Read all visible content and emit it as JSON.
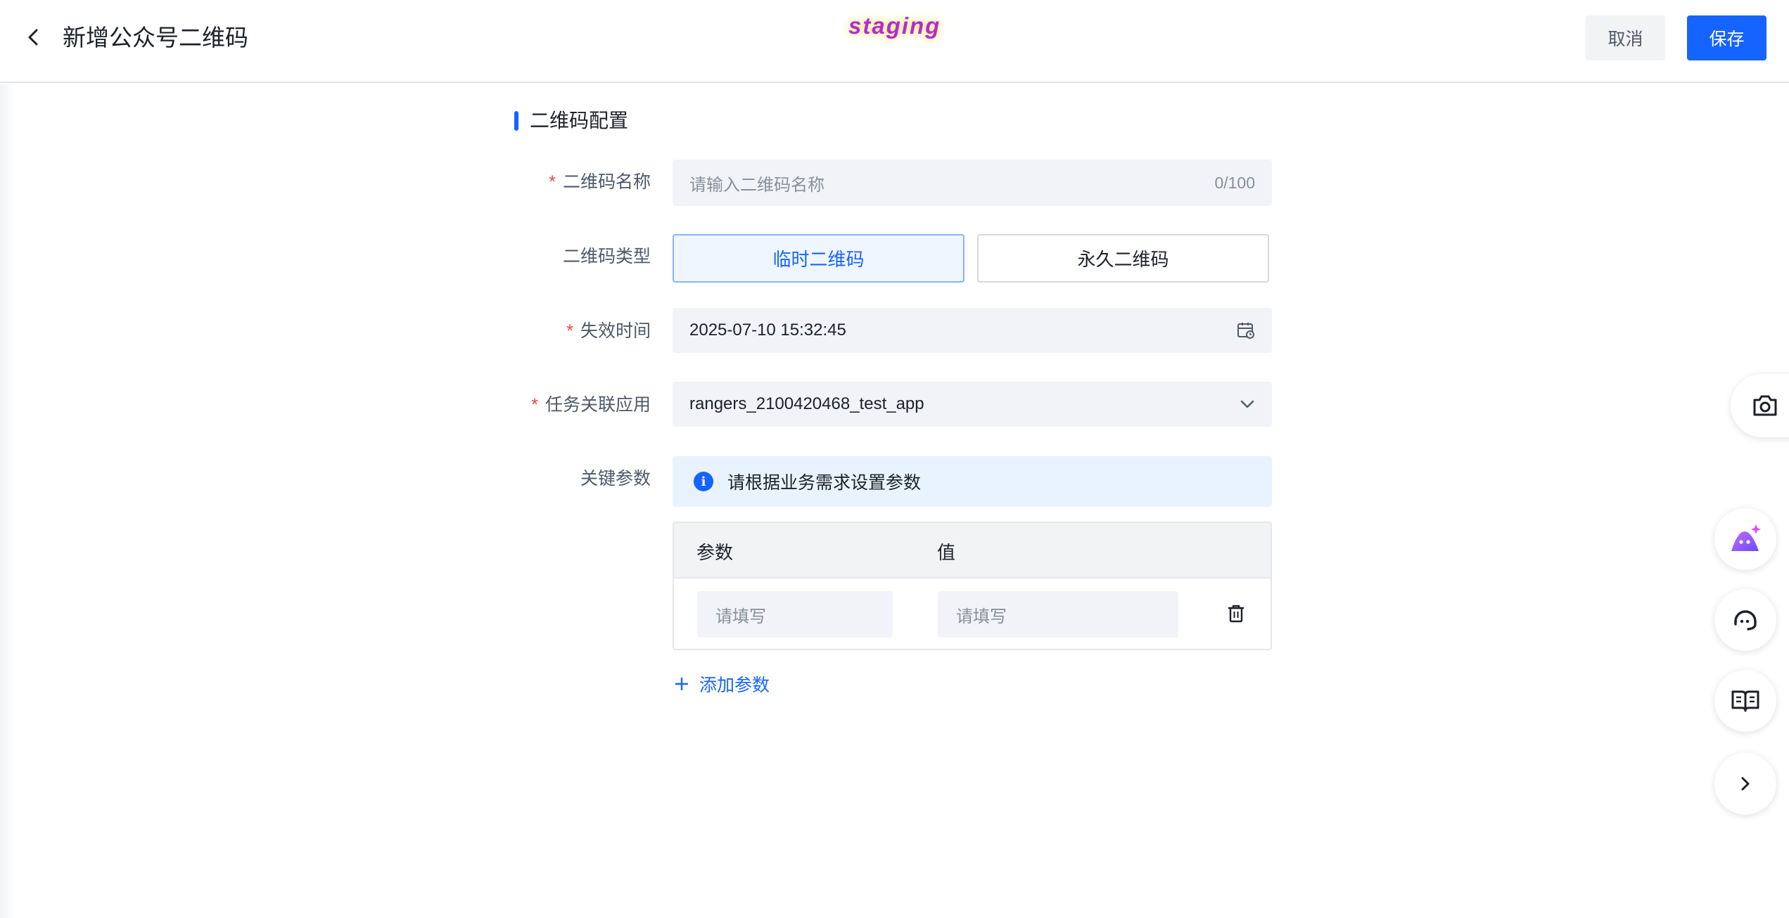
{
  "header": {
    "title": "新增公众号二维码",
    "env_badge": "staging",
    "cancel_label": "取消",
    "save_label": "保存"
  },
  "section": {
    "title": "二维码配置"
  },
  "form": {
    "name": {
      "label": "二维码名称",
      "required_mark": "*",
      "placeholder": "请输入二维码名称",
      "char_count": "0/100"
    },
    "type": {
      "label": "二维码类型",
      "options": [
        {
          "label": "临时二维码",
          "selected": true
        },
        {
          "label": "永久二维码",
          "selected": false
        }
      ]
    },
    "expire": {
      "label": "失效时间",
      "required_mark": "*",
      "value": "2025-07-10 15:32:45"
    },
    "app": {
      "label": "任务关联应用",
      "required_mark": "*",
      "value": "rangers_2100420468_test_app"
    },
    "params": {
      "label": "关键参数",
      "alert_text": "请根据业务需求设置参数",
      "columns": [
        "参数",
        "值"
      ],
      "rows": [
        {
          "param_placeholder": "请填写",
          "value_placeholder": "请填写"
        }
      ],
      "add_label": "添加参数"
    }
  },
  "colors": {
    "primary": "#1664ff",
    "required": "#f53f3f",
    "env_badge": "#b429d8"
  },
  "float_tools": [
    "camera-icon",
    "ai-assistant-icon",
    "customer-service-icon",
    "docs-book-icon",
    "chevron-right-icon"
  ]
}
